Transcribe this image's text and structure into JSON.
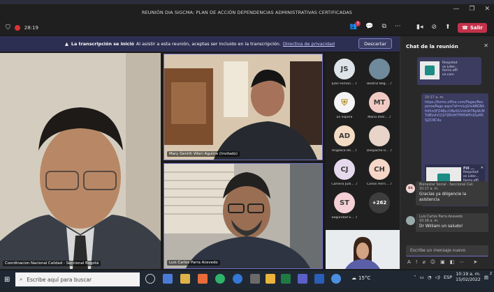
{
  "window": {
    "title": "REUNIÓN DIA SIGCMA: PLAN DE ACCIÓN DEPENDENCIAS ADMINISTRATIVAS CERTIFICADAS"
  },
  "controls": {
    "timer": "28:19",
    "leave_label": "Salir",
    "raise_badge": "3"
  },
  "banner": {
    "bold": "La transcripción se inició",
    "text": "Al asistir a esta reunión, aceptas ser incluido en la transcripción.",
    "link": "Directiva de privacidad",
    "dismiss": "Descartar"
  },
  "videos": {
    "v1_name": "Coordinacion Nacional Calidad - Seccional Bogotá",
    "v2_name": "Mary Genith Viteri Aguirre (Invitado)",
    "v3_name": "Luis Carlos Parra Acevedo"
  },
  "roster": [
    {
      "initials": "JS",
      "name": "Juan Fernan...",
      "bg": "#dde3e8"
    },
    {
      "initials": "",
      "name": "Beatriz Bog...",
      "bg": "#6f8a9a"
    },
    {
      "initials": "",
      "name": "En espera",
      "bg": "#f4f4f4"
    },
    {
      "initials": "MT",
      "name": "Maria Imel...",
      "bg": "#f1c9c3"
    },
    {
      "initials": "AD",
      "name": "Angelica Ro...",
      "bg": "#f4dcc4"
    },
    {
      "initials": "",
      "name": "Despacho 0...",
      "bg": "#e8d4c8"
    },
    {
      "initials": "CJ",
      "name": "Camera Judi...",
      "bg": "#e6d9ee"
    },
    {
      "initials": "CH",
      "name": "Carlos Hern...",
      "bg": "#f6d6c6"
    },
    {
      "initials": "ST",
      "name": "Seguridad S...",
      "bg": "#f5cfd6"
    },
    {
      "initials": "+262",
      "name": "",
      "bg": "#3d3d3d"
    }
  ],
  "chat": {
    "title": "Chat de la reunión",
    "card1_lines": [
      "Respetad",
      "os Líder...",
      "forms.offi",
      "ce.com"
    ],
    "link_time": "10:17 a. m.",
    "link_text": "https://forms.office.com/Pages/ResponsePage.aspx?id=mLoJVsiABGNhHii5nQFZ4BLcOBe91iVdn9tTRp9UMTdBVzhCQ1FZRVlHTFM5MFhSSzM5SjZCRC4u",
    "card2_title": "Fill ...",
    "card2_lines": [
      "Respetad",
      "os Líder...",
      "forms.offi",
      "ce.com"
    ],
    "m1_author": "Bienestar Social - Seccional Cali",
    "m1_time": "10:17 a. m.",
    "m1_text": "Gracias ya diligencie la asistencia",
    "m2_author": "Luis Carlos Parra Acevedo",
    "m2_time": "10:18 a. m.",
    "m2_text": "Dr William un saludo!",
    "input_placeholder": "Escribe un mensaje nuevo",
    "avatar1_initials": "BS"
  },
  "taskbar": {
    "search_placeholder": "Escribe aquí para buscar",
    "weather": "15°C",
    "lang": "ESP",
    "time": "10:19 a. m.",
    "date": "15/02/2022",
    "notif": "2"
  }
}
